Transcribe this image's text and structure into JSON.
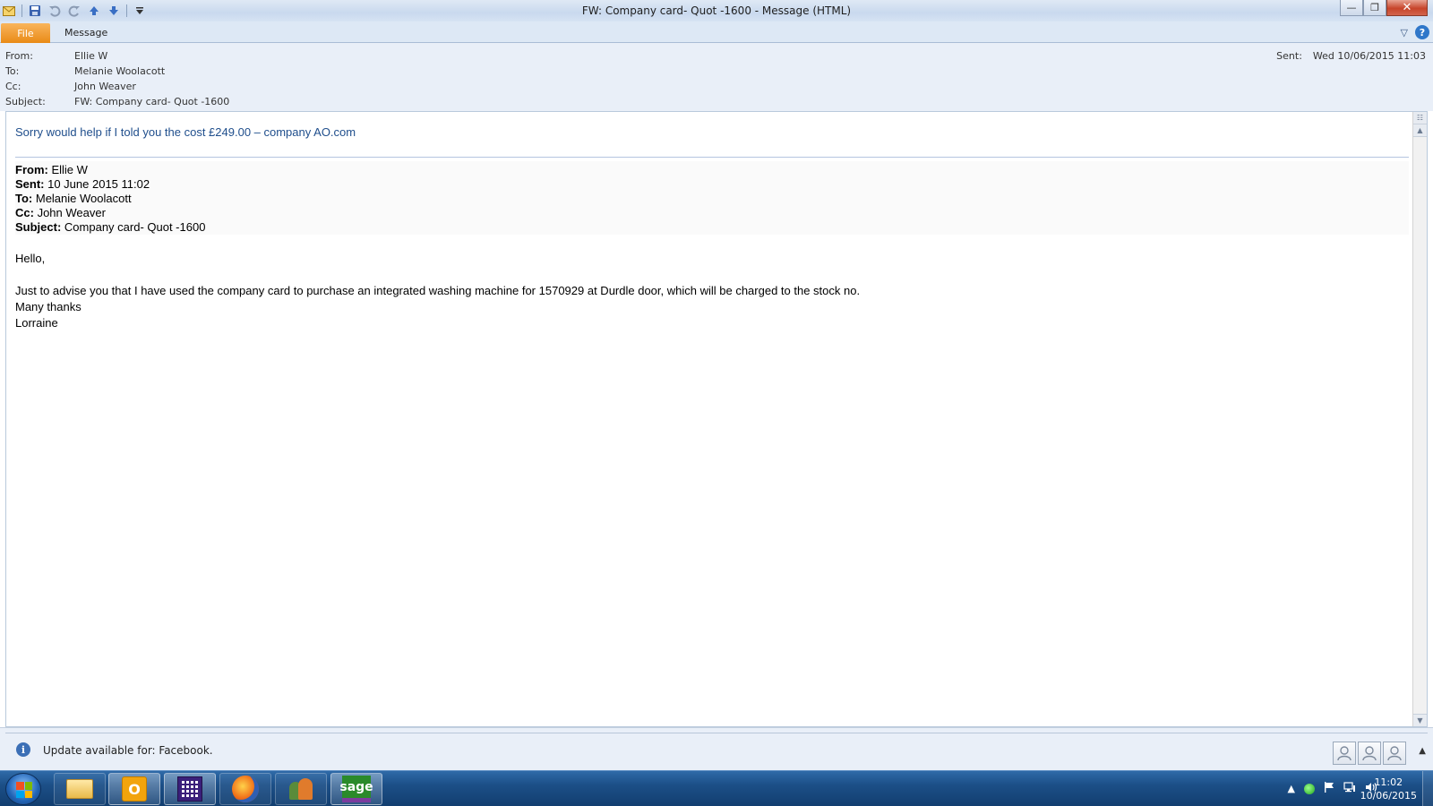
{
  "window": {
    "title": "FW: Company card- Quot -1600  -  Message (HTML)",
    "controls": {
      "minimize": "—",
      "restore": "❐",
      "close": "✕"
    }
  },
  "ribbon": {
    "tabs": [
      {
        "label": "File"
      },
      {
        "label": "Message"
      }
    ],
    "help": "?",
    "collapse": "▽"
  },
  "header": {
    "from_label": "From:",
    "from": "Ellie W",
    "to_label": "To:",
    "to": "Melanie Woolacott",
    "cc_label": "Cc:",
    "cc": "John Weaver",
    "subject_label": "Subject:",
    "subject": "FW: Company card- Quot -1600",
    "sent_label": "Sent:",
    "sent": "Wed 10/06/2015 11:03"
  },
  "body": {
    "reply_text": "Sorry would help if I told you the cost £249.00 – company AO.com",
    "forwarded": {
      "from_label": "From:",
      "from": " Ellie W",
      "sent_label": "Sent:",
      "sent": " 10 June 2015 11:02",
      "to_label": "To:",
      "to": " Melanie Woolacott",
      "cc_label": "Cc:",
      "cc": " John Weaver",
      "subject_label": "Subject:",
      "subject": " Company card- Quot -1600"
    },
    "greeting": "Hello,",
    "paragraph": "Just to advise you that I have used the company card to purchase an integrated washing machine for 1570929 at Durdle door, which will be charged to the stock no.",
    "signoff": "Many thanks",
    "signature": "Lorraine"
  },
  "status": {
    "update_text": "Update available for: Facebook.",
    "info_glyph": "i",
    "toggle": "▲"
  },
  "taskbar": {
    "apps": [
      "windows-explorer",
      "outlook",
      "calculator",
      "firefox",
      "contacts",
      "sage"
    ],
    "outlook_glyph": "O",
    "sage_label": "sage",
    "tray_arrow": "▲",
    "time": "11:02",
    "date": "10/06/2015"
  },
  "colors": {
    "file_tab": "#e98a16",
    "reply_text": "#1f4e8c",
    "close_button": "#c7452b",
    "taskbar": "#1c4f87"
  }
}
